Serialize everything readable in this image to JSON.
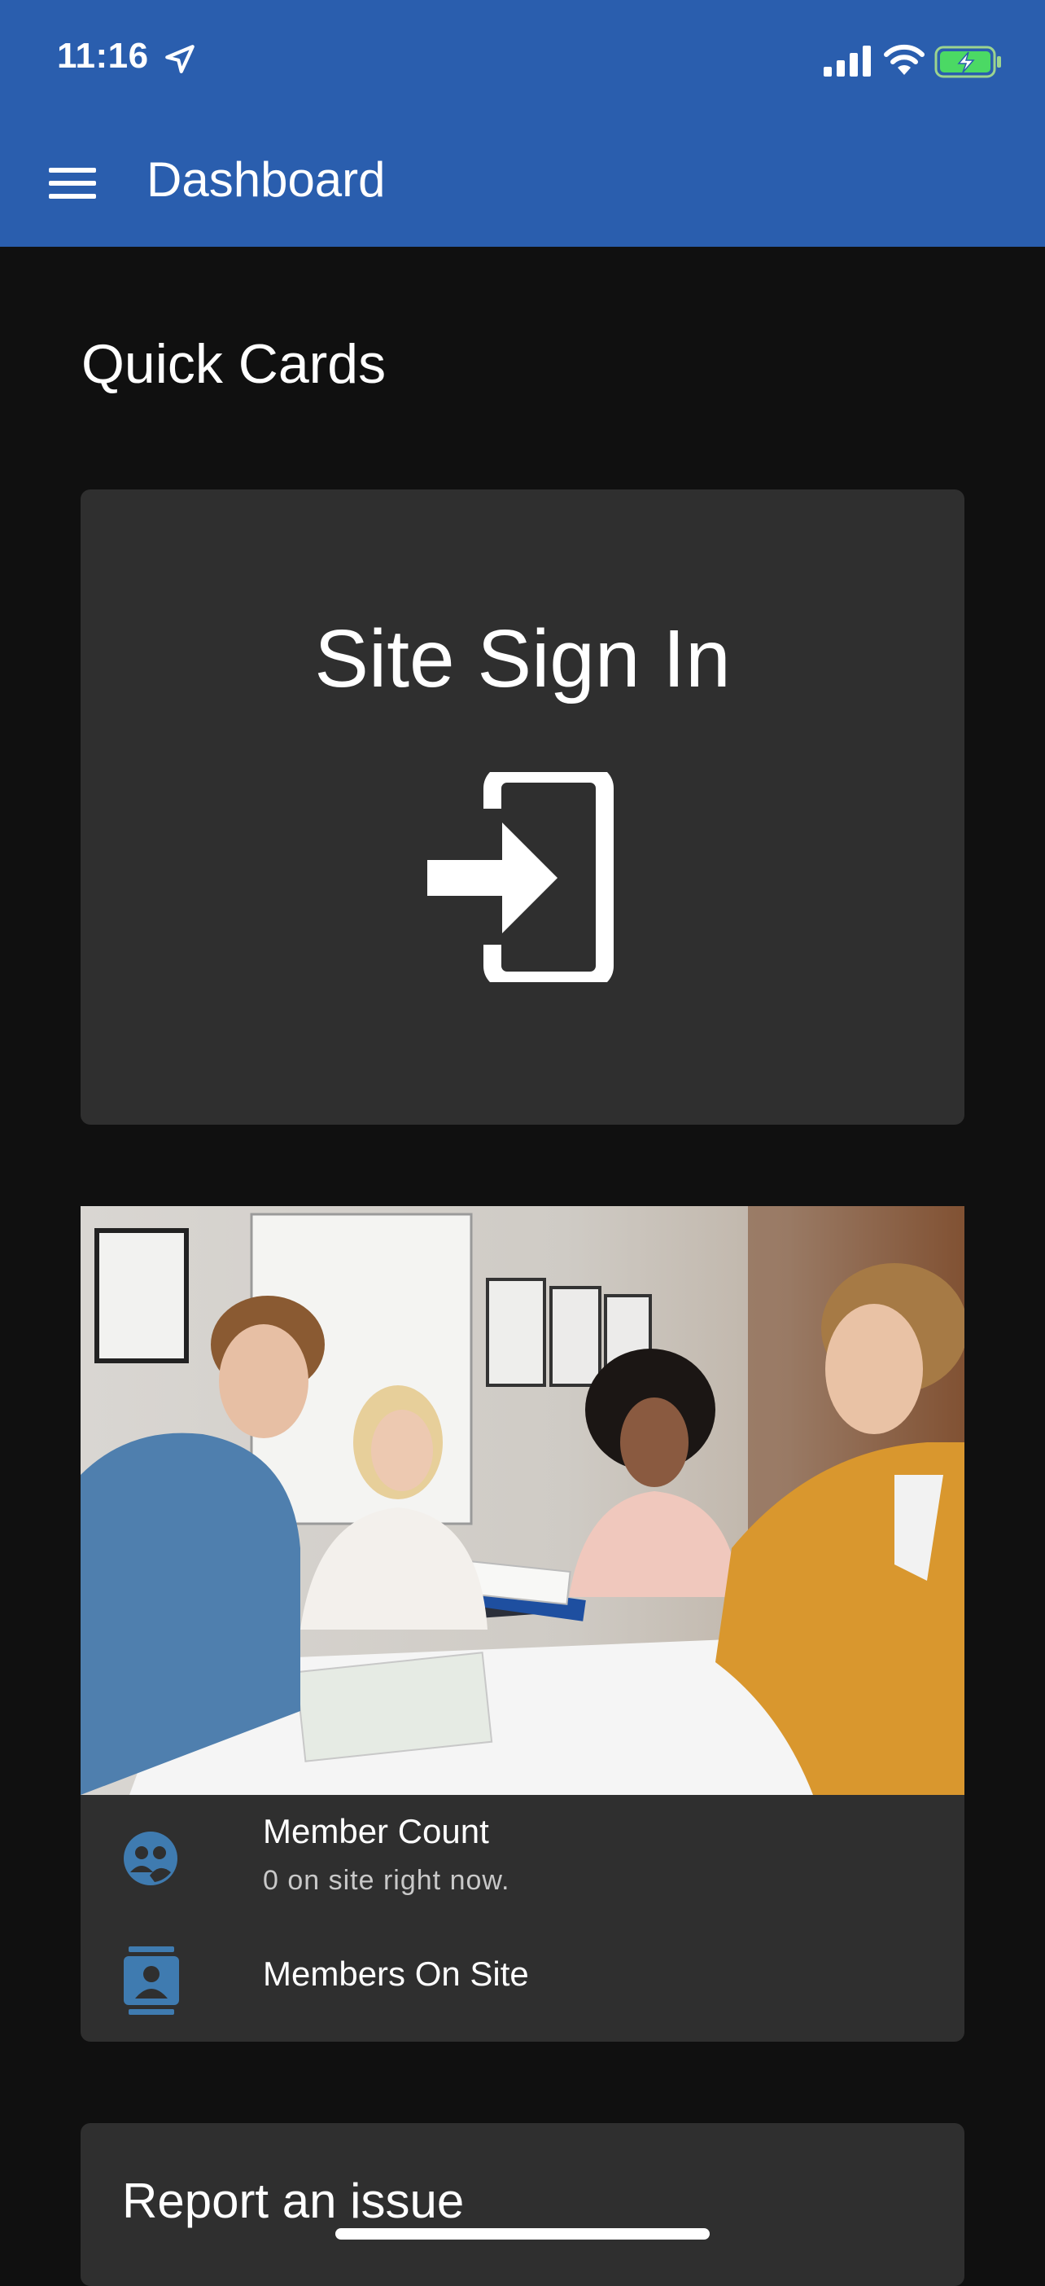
{
  "status_bar": {
    "time": "11:16",
    "icons": [
      "location-arrow-icon",
      "cellular-signal-icon",
      "wifi-icon",
      "battery-charging-icon"
    ]
  },
  "app_bar": {
    "title": "Dashboard",
    "menu_icon": "hamburger-menu-icon",
    "background": "#2a5eae"
  },
  "main": {
    "section_title": "Quick Cards",
    "signin_card": {
      "label": "Site Sign In",
      "icon": "login-icon"
    },
    "members_card": {
      "image": "photo of four people reading books at a table",
      "items": [
        {
          "icon": "people-icon",
          "primary": "Member Count",
          "secondary": "0 on site right now."
        },
        {
          "icon": "contacts-icon",
          "primary": "Members On Site"
        }
      ],
      "icon_color": "#3f7bb0"
    },
    "report_card": {
      "title": "Report an issue"
    }
  },
  "colors": {
    "page_background": "#101010",
    "card_background": "#2f2f2f",
    "accent": "#2a5eae"
  }
}
